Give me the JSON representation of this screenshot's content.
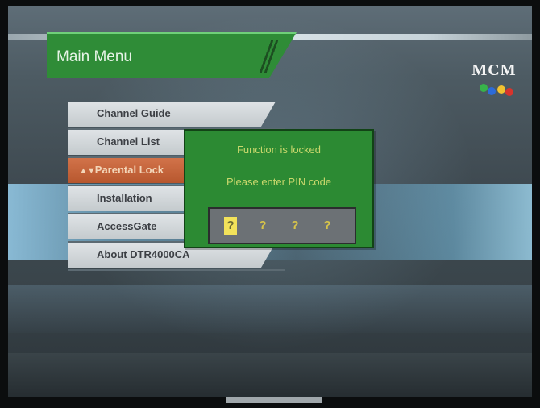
{
  "header": {
    "title": "Main Menu",
    "logo_text": "MCM"
  },
  "menu": {
    "items": [
      {
        "label": "Channel Guide",
        "active": false
      },
      {
        "label": "Channel List",
        "active": false
      },
      {
        "label": "Parental Lock",
        "active": true,
        "arrows": "▲▼"
      },
      {
        "label": "Installation",
        "active": false
      },
      {
        "label": "AccessGate",
        "active": false
      },
      {
        "label": "About DTR4000CA",
        "active": false
      }
    ]
  },
  "dialog": {
    "line1": "Function is locked",
    "line2": "Please enter PIN code",
    "pin": [
      "?",
      "?",
      "?",
      "?"
    ],
    "active_index": 0
  },
  "colors": {
    "menu_green": "#2f8c37",
    "highlight_orange": "#c4643a",
    "dialog_text": "#c9d76c",
    "pin_cursor": "#f2e25a"
  }
}
